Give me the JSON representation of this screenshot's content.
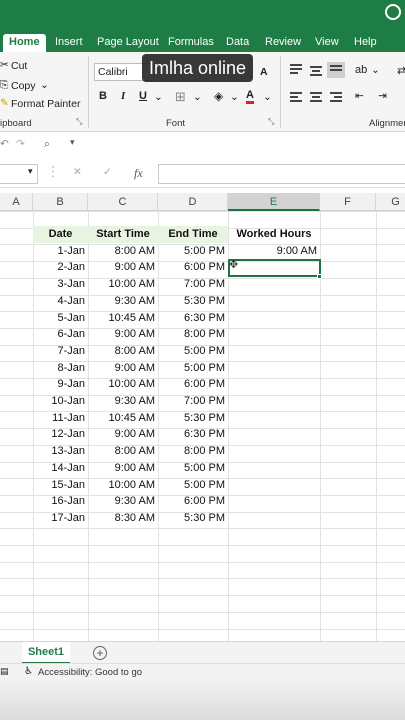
{
  "ribbon": {
    "tabs": [
      "Home",
      "Insert",
      "Page Layout",
      "Formulas",
      "Data",
      "Review",
      "View",
      "Help"
    ],
    "clipboard": {
      "cut": "Cut",
      "copy": "Copy",
      "format_painter": "Format Painter",
      "group_label": "ipboard"
    },
    "font": {
      "name": "Calibri",
      "group_label": "Font",
      "bold": "B",
      "italic": "I",
      "underline": "U",
      "increase": "A",
      "font_color": "A"
    },
    "alignment": {
      "group_label": "Alignmen"
    },
    "accent_color": "#1e7d44"
  },
  "watermark": "Imlha online",
  "formula_bar": {
    "fx": "fx",
    "value": ""
  },
  "grid": {
    "column_headers": [
      "A",
      "B",
      "C",
      "D",
      "E",
      "F",
      "G"
    ],
    "selected_column": "E",
    "table_headers": {
      "date": "Date",
      "start": "Start Time",
      "end": "End Time",
      "worked": "Worked Hours"
    },
    "rows": [
      {
        "date": "1-Jan",
        "start": "8:00 AM",
        "end": "5:00 PM",
        "worked": "9:00 AM"
      },
      {
        "date": "2-Jan",
        "start": "9:00 AM",
        "end": "6:00 PM",
        "worked": ""
      },
      {
        "date": "3-Jan",
        "start": "10:00 AM",
        "end": "7:00 PM",
        "worked": ""
      },
      {
        "date": "4-Jan",
        "start": "9:30 AM",
        "end": "5:30 PM",
        "worked": ""
      },
      {
        "date": "5-Jan",
        "start": "10:45 AM",
        "end": "6:30 PM",
        "worked": ""
      },
      {
        "date": "6-Jan",
        "start": "9:00 AM",
        "end": "8:00 PM",
        "worked": ""
      },
      {
        "date": "7-Jan",
        "start": "8:00 AM",
        "end": "5:00 PM",
        "worked": ""
      },
      {
        "date": "8-Jan",
        "start": "9:00 AM",
        "end": "5:00 PM",
        "worked": ""
      },
      {
        "date": "9-Jan",
        "start": "10:00 AM",
        "end": "6:00 PM",
        "worked": ""
      },
      {
        "date": "10-Jan",
        "start": "9:30 AM",
        "end": "7:00 PM",
        "worked": ""
      },
      {
        "date": "11-Jan",
        "start": "10:45 AM",
        "end": "5:30 PM",
        "worked": ""
      },
      {
        "date": "12-Jan",
        "start": "9:00 AM",
        "end": "6:30 PM",
        "worked": ""
      },
      {
        "date": "13-Jan",
        "start": "8:00 AM",
        "end": "8:00 PM",
        "worked": ""
      },
      {
        "date": "14-Jan",
        "start": "9:00 AM",
        "end": "5:00 PM",
        "worked": ""
      },
      {
        "date": "15-Jan",
        "start": "10:00 AM",
        "end": "5:00 PM",
        "worked": ""
      },
      {
        "date": "16-Jan",
        "start": "9:30 AM",
        "end": "6:00 PM",
        "worked": ""
      },
      {
        "date": "17-Jan",
        "start": "8:30 AM",
        "end": "5:30 PM",
        "worked": ""
      }
    ]
  },
  "sheets": {
    "active": "Sheet1",
    "add": "+"
  },
  "status": {
    "text": "Accessibility: Good to go"
  }
}
